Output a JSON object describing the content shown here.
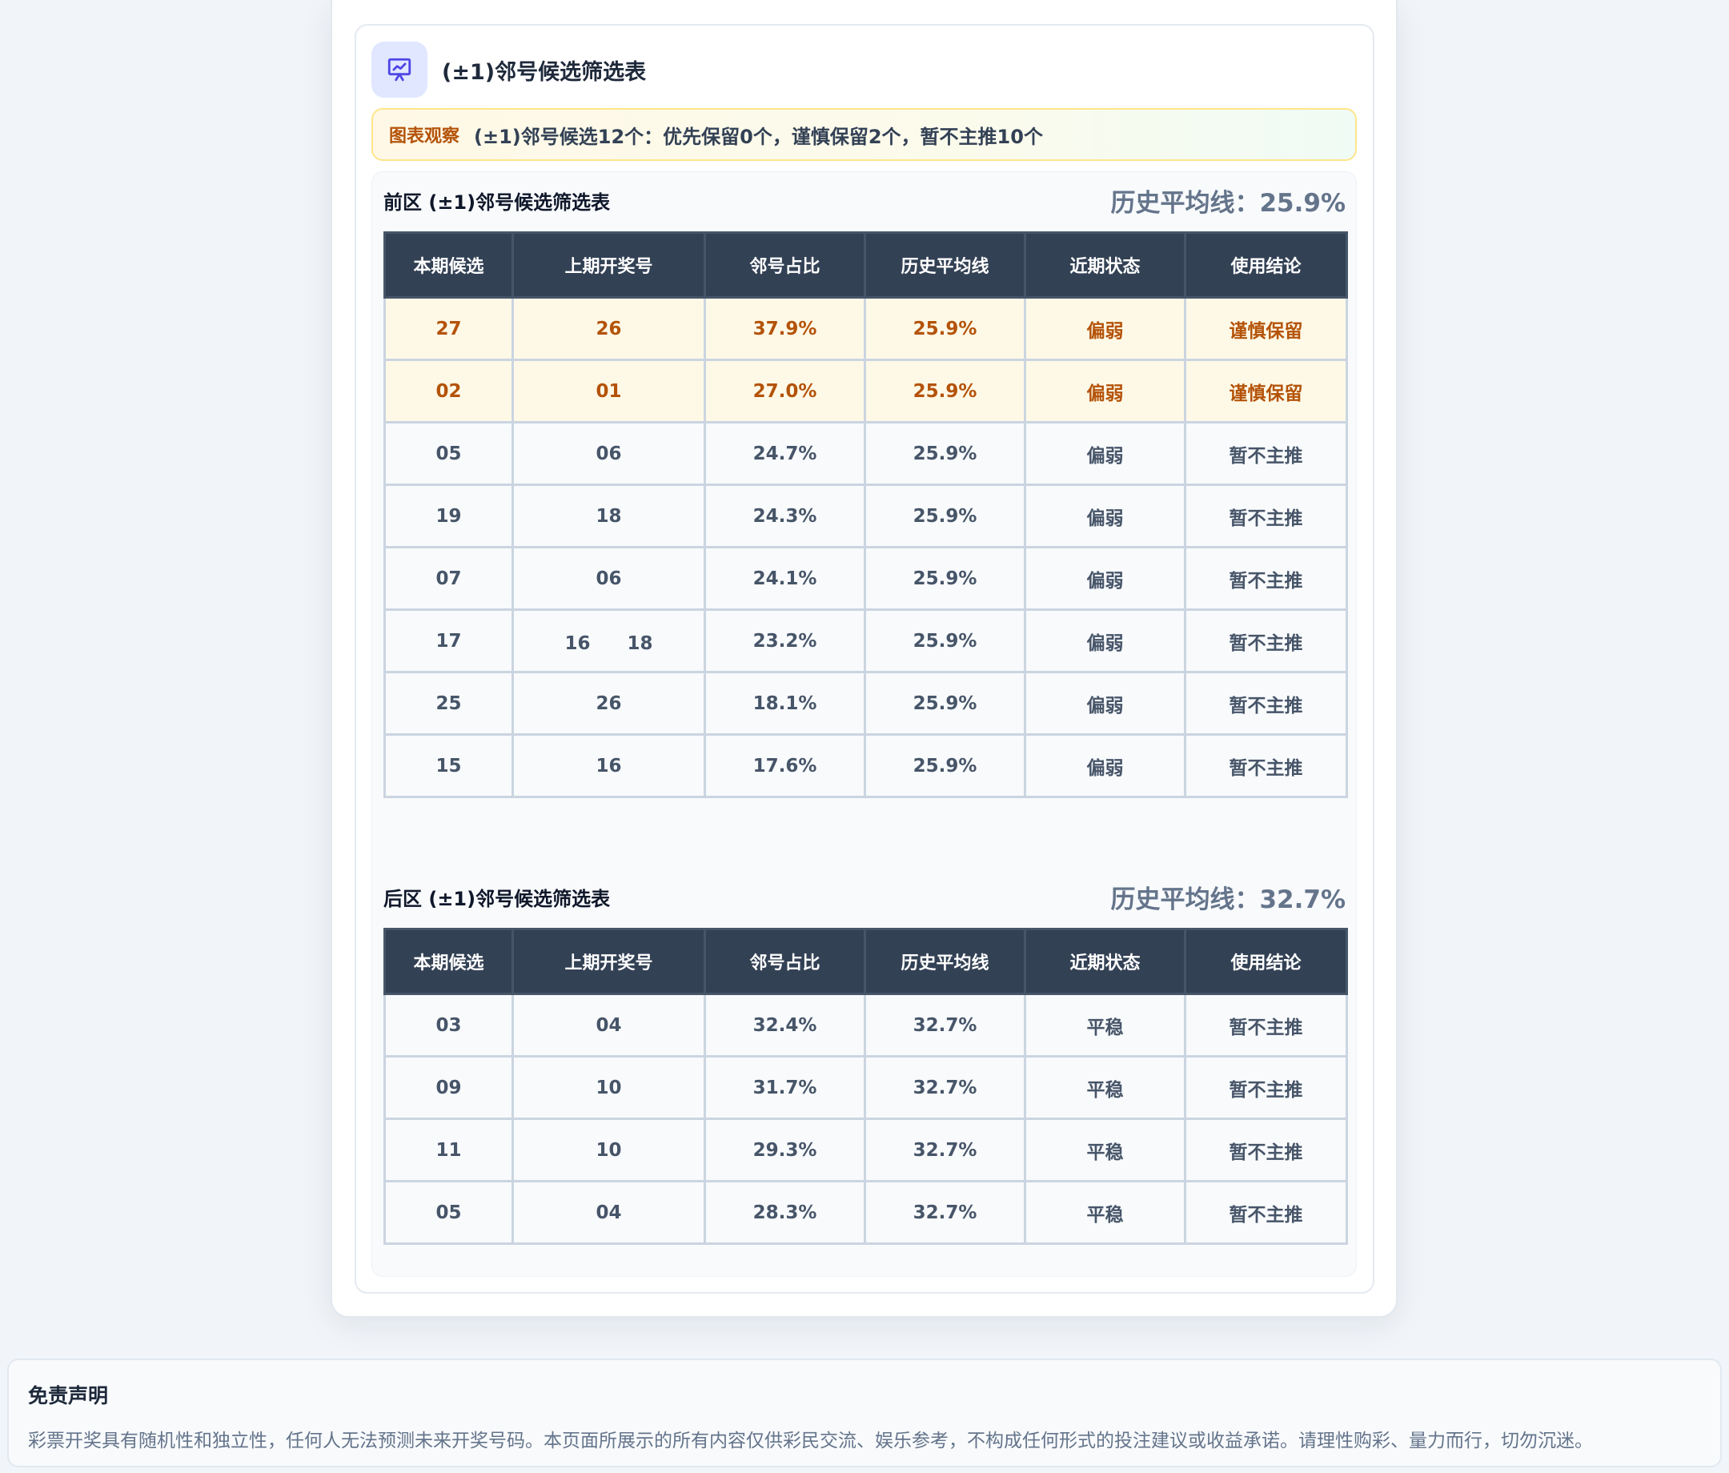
{
  "header": {
    "title": "(±1)邻号候选筛选表",
    "icon": "presentation-chart-icon"
  },
  "observation": {
    "label": "图表观察",
    "text": "(±1)邻号候选12个：优先保留0个，谨慎保留2个，暂不主推10个"
  },
  "front": {
    "title": "前区 (±1)邻号候选筛选表",
    "avg": "历史平均线：25.9%",
    "columns": [
      "本期候选",
      "上期开奖号",
      "邻号占比",
      "历史平均线",
      "近期状态",
      "使用结论"
    ],
    "rows": [
      {
        "cand": "27",
        "prev": "26",
        "ratio": "37.9%",
        "avg": "25.9%",
        "status": "偏弱",
        "conclusion": "谨慎保留",
        "highlight": true
      },
      {
        "cand": "02",
        "prev": "01",
        "ratio": "27.0%",
        "avg": "25.9%",
        "status": "偏弱",
        "conclusion": "谨慎保留",
        "highlight": true
      },
      {
        "cand": "05",
        "prev": "06",
        "ratio": "24.7%",
        "avg": "25.9%",
        "status": "偏弱",
        "conclusion": "暂不主推",
        "highlight": false
      },
      {
        "cand": "19",
        "prev": "18",
        "ratio": "24.3%",
        "avg": "25.9%",
        "status": "偏弱",
        "conclusion": "暂不主推",
        "highlight": false
      },
      {
        "cand": "07",
        "prev": "06",
        "ratio": "24.1%",
        "avg": "25.9%",
        "status": "偏弱",
        "conclusion": "暂不主推",
        "highlight": false
      },
      {
        "cand": "17",
        "prev": "16　　18",
        "ratio": "23.2%",
        "avg": "25.9%",
        "status": "偏弱",
        "conclusion": "暂不主推",
        "highlight": false
      },
      {
        "cand": "25",
        "prev": "26",
        "ratio": "18.1%",
        "avg": "25.9%",
        "status": "偏弱",
        "conclusion": "暂不主推",
        "highlight": false
      },
      {
        "cand": "15",
        "prev": "16",
        "ratio": "17.6%",
        "avg": "25.9%",
        "status": "偏弱",
        "conclusion": "暂不主推",
        "highlight": false
      }
    ]
  },
  "back": {
    "title": "后区 (±1)邻号候选筛选表",
    "avg": "历史平均线：32.7%",
    "columns": [
      "本期候选",
      "上期开奖号",
      "邻号占比",
      "历史平均线",
      "近期状态",
      "使用结论"
    ],
    "rows": [
      {
        "cand": "03",
        "prev": "04",
        "ratio": "32.4%",
        "avg": "32.7%",
        "status": "平稳",
        "conclusion": "暂不主推",
        "highlight": false
      },
      {
        "cand": "09",
        "prev": "10",
        "ratio": "31.7%",
        "avg": "32.7%",
        "status": "平稳",
        "conclusion": "暂不主推",
        "highlight": false
      },
      {
        "cand": "11",
        "prev": "10",
        "ratio": "29.3%",
        "avg": "32.7%",
        "status": "平稳",
        "conclusion": "暂不主推",
        "highlight": false
      },
      {
        "cand": "05",
        "prev": "04",
        "ratio": "28.3%",
        "avg": "32.7%",
        "status": "平稳",
        "conclusion": "暂不主推",
        "highlight": false
      }
    ]
  },
  "disclaimer": {
    "title": "免责声明",
    "text": "彩票开奖具有随机性和独立性，任何人无法预测未来开奖号码。本页面所展示的所有内容仅供彩民交流、娱乐参考，不构成任何形式的投注建议或收益承诺。请理性购彩、量力而行，切勿沉迷。"
  }
}
